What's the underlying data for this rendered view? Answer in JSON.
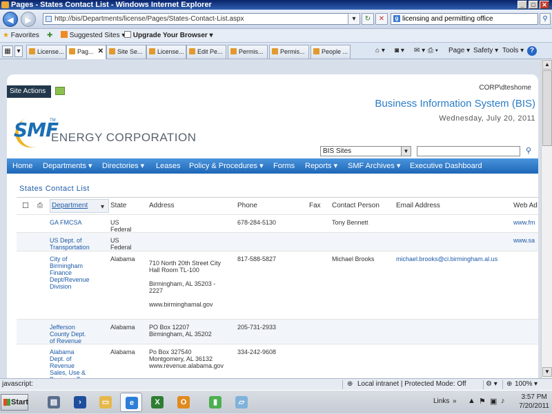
{
  "window": {
    "title": "Pages - States Contact List - Windows Internet Explorer",
    "min": "_",
    "max": "□",
    "close": "✕"
  },
  "address": {
    "url": "http://bis/Departments/license/Pages/States-Contact-List.aspx",
    "search_text": "licensing and permitting office",
    "refresh": "↻",
    "stop": "✕",
    "back": "◀",
    "forward": "▶"
  },
  "favorites": {
    "label": "Favorites",
    "suggested": "Suggested Sites ▾",
    "upgrade": "Upgrade Your Browser ▾"
  },
  "tabs": [
    {
      "label": "License..."
    },
    {
      "label": "Pag...",
      "active": true
    },
    {
      "label": "Site Se..."
    },
    {
      "label": "License..."
    },
    {
      "label": "Edit Pe..."
    },
    {
      "label": "Permis..."
    },
    {
      "label": "Permis..."
    },
    {
      "label": "People ..."
    }
  ],
  "commands": {
    "page": "Page ▾",
    "safety": "Safety ▾",
    "tools": "Tools ▾",
    "help": "?"
  },
  "sp": {
    "site_actions": "Site Actions ▾",
    "user": "CORP\\dteshome",
    "site_title": "Business Information System (BIS)",
    "date": "Wednesday, July 20, 2011",
    "logo_smf": "SMF",
    "logo_tm": "TM",
    "logo_energy": "ENERGY CORPORATION",
    "scope": "BIS Sites",
    "search_go": "⚲",
    "nav": [
      "Home",
      "Departments ▾",
      "Directories ▾",
      "Leases",
      "Policy & Procedures ▾",
      "Forms",
      "Reports ▾",
      "SMF Archives ▾",
      "Executive Dashboard"
    ],
    "list_title": "States Contact List",
    "columns": [
      "Department",
      "State",
      "Address",
      "Phone",
      "Fax",
      "Contact Person",
      "Email Address",
      "Web Ad"
    ],
    "rows": [
      {
        "dept": "GA FMCSA",
        "state": "US\nFederal",
        "address": "",
        "phone": "678-284-5130",
        "contact": "Tony Bennett",
        "email": "",
        "web": "www.fm"
      },
      {
        "dept": "US Dept. of\nTransportation",
        "state": "US\nFederal",
        "address": "",
        "phone": "",
        "contact": "",
        "email": "",
        "web": "www.sa"
      },
      {
        "dept": "City of\nBirmingham\nFinance\nDept/Revenue\nDivision",
        "state": "Alabama",
        "address": "710 North 20th Street City\nHall Room TL-100\n\nBirmingham, AL 35203 -\n2227\n\nwww.birminghamal.gov",
        "phone": "817-588-5827",
        "contact": "Michael Brooks",
        "email": "michael.brooks@ci.birmingham.al.us",
        "web": ""
      },
      {
        "dept": "Jefferson\nCounty Dept.\nof Revenue",
        "state": "Alabama",
        "address": "PO Box 12207\nBirmingham, AL 35202",
        "phone": "205-731-2933",
        "contact": "",
        "email": "",
        "web": ""
      },
      {
        "dept": "Alabama\nDept. of\nRevenue\nSales, Use &\nBusiness Tax",
        "state": "Alabama",
        "address": "Po Box 327540\nMontgomery, AL 36132\nwww.revenue.alabama.gov",
        "phone": "334-242-9608",
        "contact": "",
        "email": "",
        "web": ""
      }
    ]
  },
  "status": {
    "left": "javascript:",
    "zone": "Local intranet | Protected Mode: Off",
    "zoom": "100%"
  },
  "taskbar": {
    "start": "Start",
    "links": "Links",
    "time": "3:57 PM",
    "date": "7/20/2011"
  }
}
